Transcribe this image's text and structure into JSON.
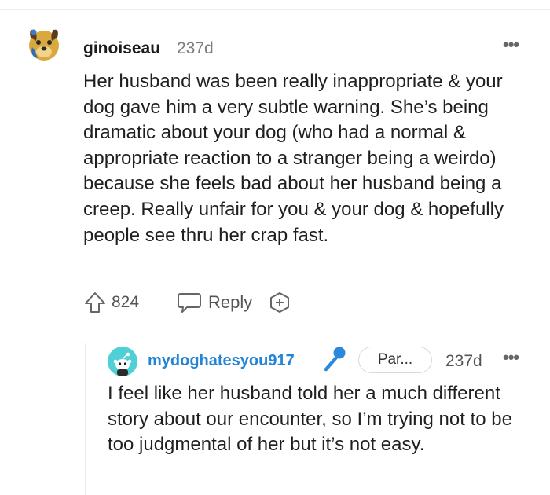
{
  "comment": {
    "author": "ginoiseau",
    "age": "237d",
    "more": "•••",
    "body": "Her husband was been really inappropriate & your dog gave him a very subtle warning. She’s being dramatic about your dog (who had a normal & appropriate reaction to a stranger being a weirdo) because she feels bad about her husband being a creep. Really unfair for you & your dog & hopefully people see thru her crap fast.",
    "score": "824",
    "reply_label": "Reply"
  },
  "reply": {
    "author": "mydoghatesyou917",
    "flair": "Par...",
    "age": "237d",
    "more": "•••",
    "body": "I feel like her husband told her a much different story about our encounter, so I’m trying not to be too judgmental of her but it’s not easy."
  },
  "colors": {
    "reply_author": "#2484d6",
    "mic": "#2a89d8",
    "avatar_reply": "#4fcfd6"
  },
  "icons": [
    "dog-avatar-icon",
    "menu-dots-icon",
    "upvote-arrow-icon",
    "reply-bubble-icon",
    "award-plus-icon",
    "snoo-avatar-icon",
    "microphone-icon"
  ]
}
